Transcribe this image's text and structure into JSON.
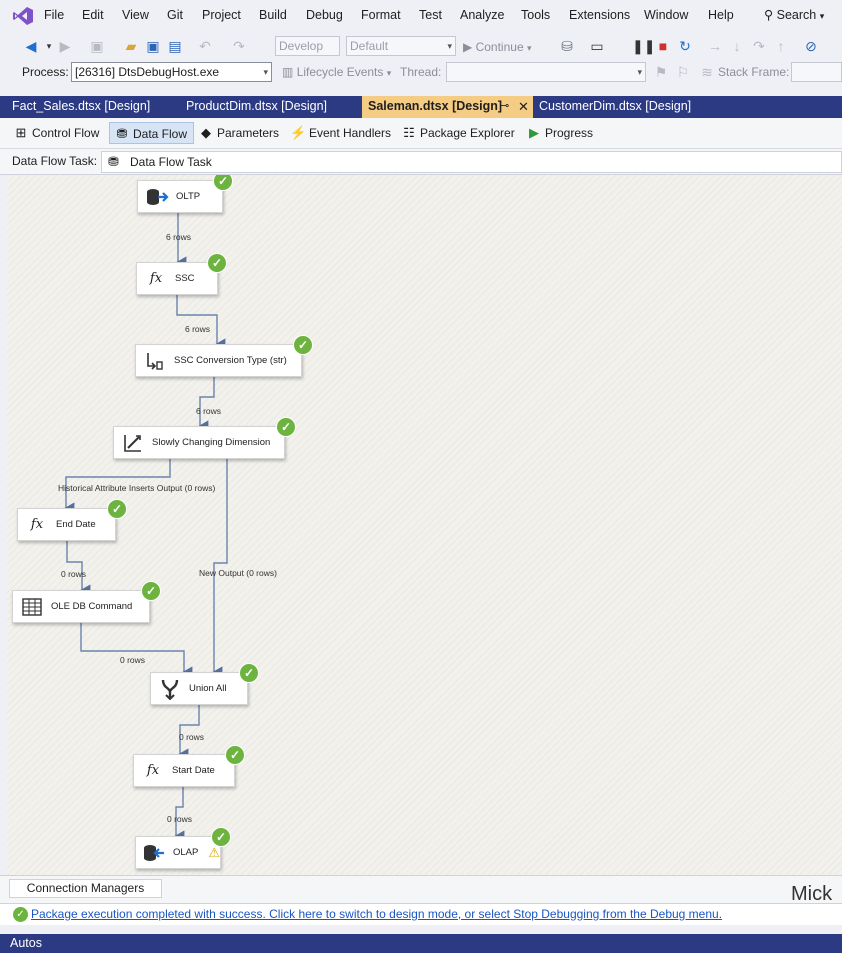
{
  "menu": [
    "File",
    "Edit",
    "View",
    "Git",
    "Project",
    "Build",
    "Debug",
    "Format",
    "Test",
    "Analyze",
    "Tools",
    "Extensions",
    "Window",
    "Help"
  ],
  "search_label": "Search",
  "toolbar": {
    "config_combo": "Develop",
    "platform_combo": "Default",
    "continue_label": "Continue"
  },
  "toolbar2": {
    "process_label": "Process:",
    "process_value": "[26316] DtsDebugHost.exe",
    "lifecycle_label": "Lifecycle Events",
    "thread_label": "Thread:",
    "stack_label": "Stack Frame:"
  },
  "doc_tabs": [
    {
      "label": "Fact_Sales.dtsx [Design]"
    },
    {
      "label": "ProductDim.dtsx [Design]"
    },
    {
      "label": "Saleman.dtsx [Design]"
    },
    {
      "label": "CustomerDim.dtsx [Design]"
    }
  ],
  "designer_tabs": [
    "Control Flow",
    "Data Flow",
    "Parameters",
    "Event Handlers",
    "Package Explorer",
    "Progress"
  ],
  "task": {
    "label": "Data Flow Task:",
    "value": "Data Flow Task"
  },
  "nodes": [
    {
      "label": "OLTP"
    },
    {
      "label": "SSC"
    },
    {
      "label": "SSC Conversion Type (str)"
    },
    {
      "label": "Slowly Changing Dimension"
    },
    {
      "label": "End Date"
    },
    {
      "label": "OLE DB Command"
    },
    {
      "label": "Union All"
    },
    {
      "label": "Start Date"
    },
    {
      "label": "OLAP"
    }
  ],
  "flows": [
    "6 rows",
    "6 rows",
    "6 rows",
    "Historical Attribute Inserts Output (0 rows)",
    "0 rows",
    "New Output (0 rows)",
    "0 rows",
    "0 rows",
    "0 rows"
  ],
  "bottom": {
    "connection_managers": "Connection Managers",
    "status_message": "Package execution completed with success. Click here to switch to design mode, or select Stop Debugging from the Debug menu.",
    "autos": "Autos",
    "watermark": "Mick"
  },
  "colors": {
    "tabstrip": "#2b3a82",
    "active_tab": "#f5cc84",
    "success": "#6db33f",
    "link": "#1a55c4"
  }
}
